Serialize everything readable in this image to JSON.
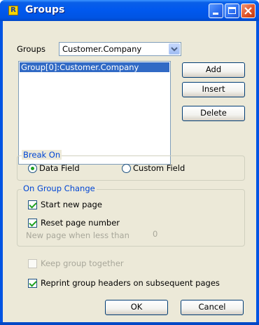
{
  "window": {
    "title": "Groups",
    "app_icon_glyph": "R"
  },
  "groups": {
    "label": "Groups",
    "combo_value": "Customer.Company",
    "list_items": [
      "Group[0]:Customer.Company"
    ]
  },
  "buttons": {
    "add": "Add",
    "insert": "Insert",
    "delete": "Delete",
    "ok": "OK",
    "cancel": "Cancel"
  },
  "break_on": {
    "title": "Break On",
    "data_field": "Data Field",
    "custom_field": "Custom Field",
    "selected": "data_field"
  },
  "on_group_change": {
    "title": "On Group Change",
    "start_new_page": "Start new page",
    "reset_page_number": "Reset page number",
    "new_page_when_less_than": "New page when less than",
    "new_page_value": "0"
  },
  "options": {
    "keep_group_together": "Keep group together",
    "reprint_headers": "Reprint group headers on subsequent pages"
  },
  "colors": {
    "title_bar": "#0054e3",
    "dialog_bg": "#ece9d8",
    "selection": "#316ac5",
    "group_title": "#0046d5"
  }
}
